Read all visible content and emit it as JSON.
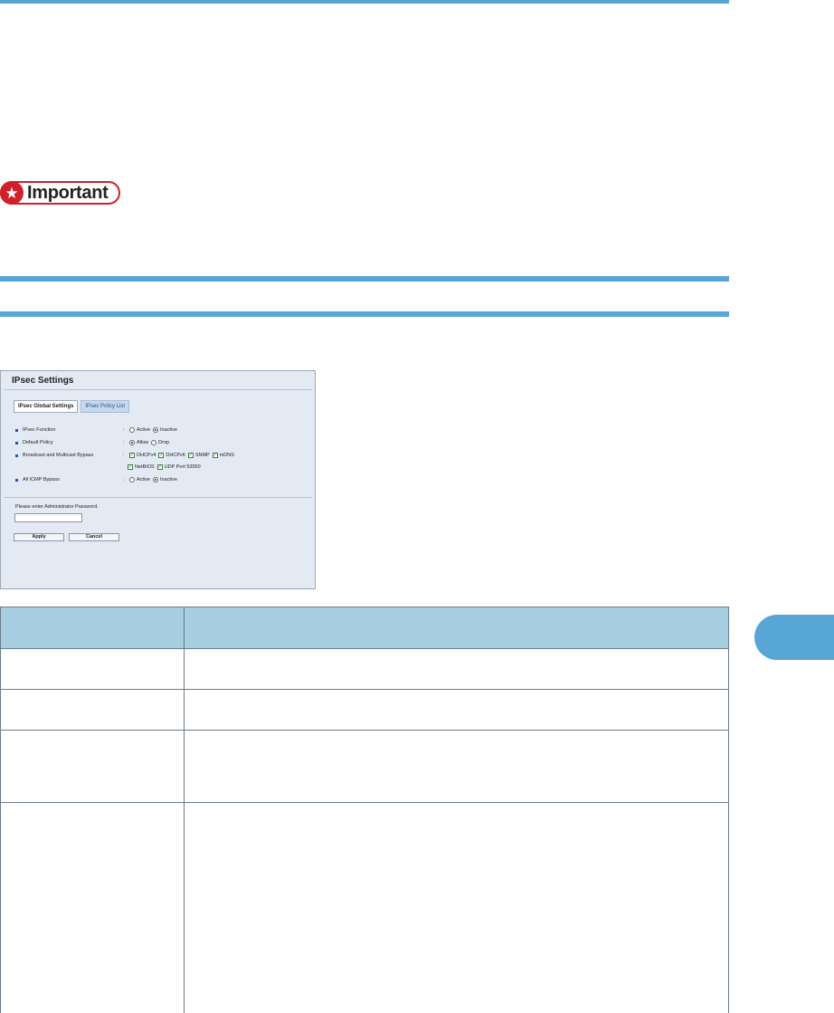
{
  "notice": {
    "label": "Important"
  },
  "screenshot": {
    "title": "IPsec Settings",
    "tabs": [
      {
        "label": "IPsec Global Settings",
        "active": true
      },
      {
        "label": "IPsec Policy List",
        "active": false
      }
    ],
    "rows": {
      "ipsec_function": {
        "label": "IPsec Function",
        "options": [
          "Active",
          "Inactive"
        ],
        "selected": "Inactive"
      },
      "default_policy": {
        "label": "Default Policy",
        "options": [
          "Allow",
          "Drop"
        ],
        "selected": "Allow"
      },
      "bypass": {
        "label": "Broadcast and Multicast Bypass",
        "checks_line1": [
          "DHCPv4",
          "DHCPv6",
          "SNMP",
          "mDNS"
        ],
        "checks_line2": [
          "NetBIOS",
          "UDP Port 53550"
        ]
      },
      "icmp_bypass": {
        "label": "All ICMP Bypass",
        "options": [
          "Active",
          "Inactive"
        ],
        "selected": "Inactive"
      }
    },
    "password_prompt": "Please enter Administrator Password.",
    "password_value": "",
    "buttons": {
      "apply": "Apply",
      "cancel": "Cancel"
    }
  },
  "colors": {
    "accent": "#58a6d6",
    "table_header": "#a7cde0",
    "important": "#d0202a"
  }
}
